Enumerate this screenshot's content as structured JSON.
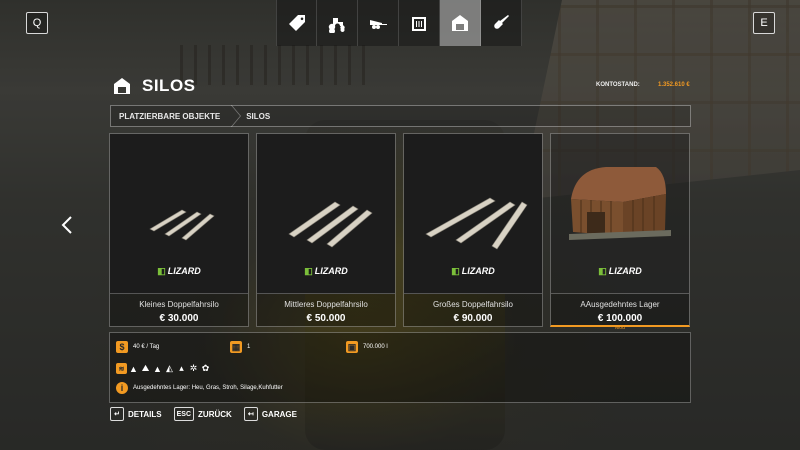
{
  "topbar": {
    "left_key": "Q",
    "right_key": "E",
    "tabs": [
      {
        "icon": "price-tag-icon",
        "active": false
      },
      {
        "icon": "tractor-icon",
        "active": false
      },
      {
        "icon": "trailer-icon",
        "active": false
      },
      {
        "icon": "building-icon",
        "active": false
      },
      {
        "icon": "barn-icon",
        "active": true
      },
      {
        "icon": "shovel-icon",
        "active": false
      }
    ]
  },
  "header": {
    "title": "SILOS",
    "balance_label": "KONTOSTAND:",
    "balance_value": "1.352.610 €"
  },
  "breadcrumb": [
    "PLATZIERBARE OBJEKTE",
    "SILOS"
  ],
  "cards": [
    {
      "brand": "LIZARD",
      "name": "Kleines Doppelfahrsilo",
      "price": "€ 30.000",
      "mod": ""
    },
    {
      "brand": "LIZARD",
      "name": "Mittleres Doppelfahrsilo",
      "price": "€ 50.000",
      "mod": ""
    },
    {
      "brand": "LIZARD",
      "name": "Großes Doppelfahrsilo",
      "price": "€ 90.000",
      "mod": ""
    },
    {
      "brand": "LIZARD",
      "name": "AAusgedehntes Lager",
      "price": "€ 100.000",
      "mod": "Mod"
    }
  ],
  "info": {
    "upkeep": "40 € / Tag",
    "slots": "1",
    "capacity": "700.000 l",
    "description": "Ausgedehntes Lager: Heu, Gras, Stroh, Silage,Kuhfutter"
  },
  "footer": {
    "details_key": "↵",
    "details_label": "DETAILS",
    "back_key": "ESC",
    "back_label": "ZURÜCK",
    "garage_key": "↤",
    "garage_label": "GARAGE"
  },
  "colors": {
    "accent": "#f29a22",
    "brand_green": "#7bbf3a"
  }
}
